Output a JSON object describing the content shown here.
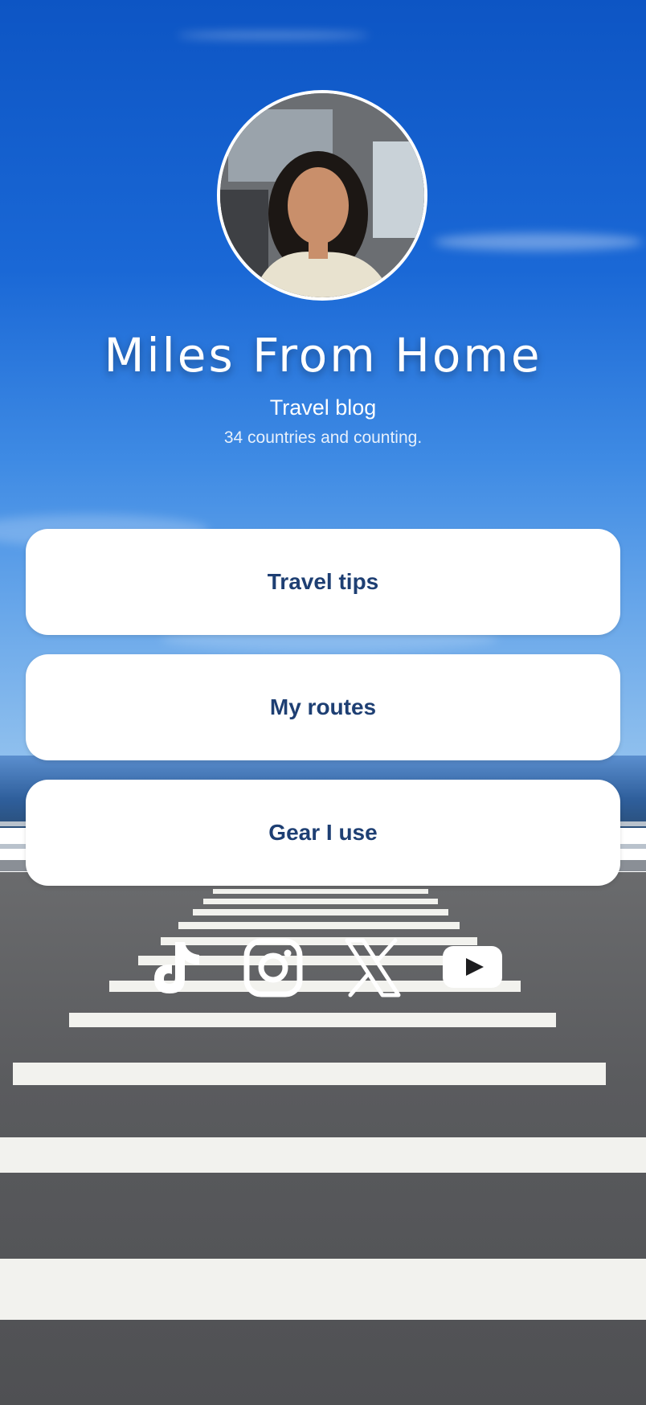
{
  "profile": {
    "title": "Miles From Home",
    "subtitle": "Travel blog",
    "tagline": "34 countries and counting."
  },
  "links": [
    {
      "label": "Travel tips"
    },
    {
      "label": "My routes"
    },
    {
      "label": "Gear I use"
    }
  ],
  "socials": [
    {
      "icon": "tiktok-icon"
    },
    {
      "icon": "instagram-icon"
    },
    {
      "icon": "x-icon"
    },
    {
      "icon": "youtube-icon"
    }
  ],
  "colors": {
    "link_text": "#1e3f73",
    "button_background": "#ffffff",
    "sky": "#1a68d6"
  }
}
